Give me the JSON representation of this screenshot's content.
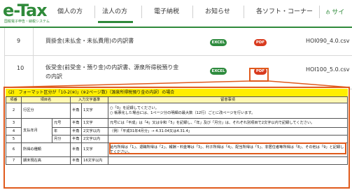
{
  "header": {
    "logo": "e-Tax",
    "logo_sub": "国税電子申告・納税システム",
    "nav": [
      {
        "label": "個人の方"
      },
      {
        "label": "法人の方"
      },
      {
        "label": "電子納税"
      },
      {
        "label": "お知らせ"
      },
      {
        "label": "各ソフト・コーナー"
      },
      {
        "label": "サイ"
      }
    ]
  },
  "files": [
    {
      "num": "9",
      "desc_line1": "買掛金(未払金・未払費用)の内訳書",
      "desc_line2": "",
      "excel": "EXCEL",
      "pdf": "PDF",
      "filename": "HOI090_4.0.csv"
    },
    {
      "num": "10",
      "desc_line1": "仮受金(前受金・預り金)の内訳書、源泉所得税預り金",
      "desc_line2": "の内訳",
      "excel": "EXCEL",
      "pdf": "PDF",
      "filename": "HOI100_5.0.csv"
    }
  ],
  "spec": {
    "title": "(2)　フォーマット区分が「10-2(※)」(※2ページ数)（源泉所得税預り金の内訳）の場合",
    "headers": [
      "項番",
      "項目名",
      "",
      "入力文字基準",
      "",
      "留意事項"
    ],
    "rows": [
      {
        "no": "2",
        "name": "行区分",
        "sub": "",
        "type": "半角",
        "limit": "1文字",
        "note": "○「0」を記録してください。\n○ 帳票化した場合には、1ページ分の明細の最大数（12行）ごとに改ページを行います。"
      },
      {
        "no": "3",
        "name": "支払年月",
        "sub": "元号",
        "type": "半角",
        "limit": "1文字",
        "note": "元号には「平成」は「4」又は令和「5」を記録し、「年」及び「月分」は、それぞれ別項目で2文字以内で記録してください。"
      },
      {
        "no": "4",
        "name": "",
        "sub": "年",
        "type": "半角",
        "limit": "2文字以内",
        "note": "（例）「平成31年4月分」→ 4.31.04又は4.31.4」"
      },
      {
        "no": "5",
        "name": "",
        "sub": "月分",
        "type": "半角",
        "limit": "2文字以内",
        "note": ""
      },
      {
        "no": "6",
        "name": "所得の種類",
        "sub": "",
        "type": "半角",
        "limit": "1文字",
        "note": "給与所得は「1」、退職所得は「2」、報酬・料金等は「3」、利子所得は「4」、配当所得は「5」、非居住者等所得は「8」、その他は「9」と記録してください。"
      },
      {
        "no": "7",
        "name": "期末現在高",
        "sub": "",
        "type": "半角",
        "limit": "16文字以内",
        "note": ""
      }
    ]
  },
  "colors": {
    "brand_green": "#2f8a3a",
    "highlight": "#e05a1c",
    "excel": "#2e8b3e",
    "pdf": "#d83a1e",
    "title_bg": "#ffee00"
  }
}
